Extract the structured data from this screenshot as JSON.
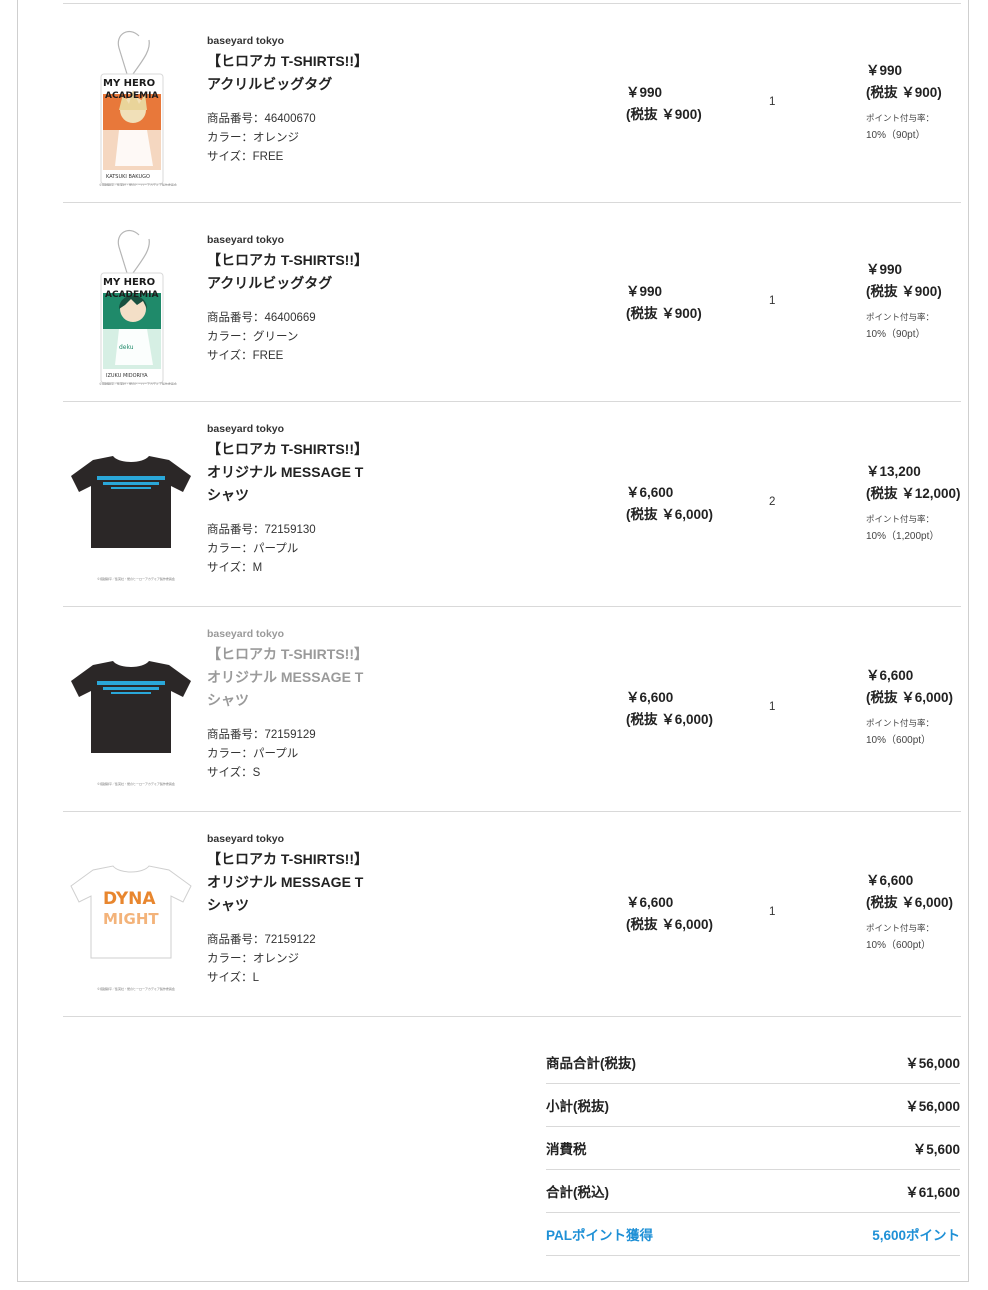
{
  "items": [
    {
      "brand": "baseyard tokyo",
      "name": "【ヒロアカ T-SHIRTS!!】アクリルビッグタグ",
      "code": "商品番号：46400670",
      "color": "カラー：オレンジ",
      "size": "サイズ：FREE",
      "unit_price": "￥990",
      "unit_price_ex": "(税抜 ￥900)",
      "qty": "1",
      "subtotal": "￥990",
      "subtotal_ex": "(税抜 ￥900)",
      "points_label": "ポイント付与率：",
      "points_value": "10%（90pt）",
      "thumb": {
        "kind": "tag",
        "accent": "#e8783a",
        "logo": "MY HERO ACADEMIA",
        "caption": "KATSUKI BAKUGO"
      }
    },
    {
      "brand": "baseyard tokyo",
      "name": "【ヒロアカ T-SHIRTS!!】アクリルビッグタグ",
      "code": "商品番号：46400669",
      "color": "カラー：グリーン",
      "size": "サイズ：FREE",
      "unit_price": "￥990",
      "unit_price_ex": "(税抜 ￥900)",
      "qty": "1",
      "subtotal": "￥990",
      "subtotal_ex": "(税抜 ￥900)",
      "points_label": "ポイント付与率：",
      "points_value": "10%（90pt）",
      "thumb": {
        "kind": "tag",
        "accent": "#1f8a6a",
        "logo": "MY HERO ACADEMIA",
        "caption": "IZUKU MIDORIYA"
      }
    },
    {
      "brand": "baseyard tokyo",
      "name": "【ヒロアカ T-SHIRTS!!】オリジナル MESSAGE Tシャツ",
      "code": "商品番号：72159130",
      "color": "カラー：パープル",
      "size": "サイズ：M",
      "unit_price": "￥6,600",
      "unit_price_ex": "(税抜 ￥6,000)",
      "qty": "2",
      "subtotal": "￥13,200",
      "subtotal_ex": "(税抜 ￥12,000)",
      "points_label": "ポイント付与率：",
      "points_value": "10%（1,200pt）",
      "thumb": {
        "kind": "tee",
        "body": "#2b2727",
        "accent": "#2aa7d9"
      }
    },
    {
      "brand": "baseyard tokyo",
      "name": "【ヒロアカ T-SHIRTS!!】オリジナル MESSAGE Tシャツ",
      "code": "商品番号：72159129",
      "color": "カラー：パープル",
      "size": "サイズ：S",
      "unit_price": "￥6,600",
      "unit_price_ex": "(税抜 ￥6,000)",
      "qty": "1",
      "subtotal": "￥6,600",
      "subtotal_ex": "(税抜 ￥6,000)",
      "points_label": "ポイント付与率：",
      "points_value": "10%（600pt）",
      "thumb": {
        "kind": "tee",
        "body": "#2b2727",
        "accent": "#2aa7d9"
      }
    },
    {
      "brand": "baseyard tokyo",
      "name": "【ヒロアカ T-SHIRTS!!】オリジナル MESSAGE Tシャツ",
      "code": "商品番号：72159122",
      "color": "カラー：オレンジ",
      "size": "サイズ：L",
      "unit_price": "￥6,600",
      "unit_price_ex": "(税抜 ￥6,000)",
      "qty": "1",
      "subtotal": "￥6,600",
      "subtotal_ex": "(税抜 ￥6,000)",
      "points_label": "ポイント付与率：",
      "points_value": "10%（600pt）",
      "thumb": {
        "kind": "tee",
        "body": "#ffffff",
        "accent": "#e8862e",
        "print": "DYNA MIGHT"
      }
    }
  ],
  "summary": {
    "items_total_label": "商品合計(税抜)",
    "items_total": "￥56,000",
    "subtotal_label": "小計(税抜)",
    "subtotal": "￥56,000",
    "tax_label": "消費税",
    "tax": "￥5,600",
    "total_label": "合計(税込)",
    "total": "￥61,600",
    "pal_label": "PALポイント獲得",
    "pal_points": "5,600ポイント",
    "pal_color": "#1e90d6"
  }
}
